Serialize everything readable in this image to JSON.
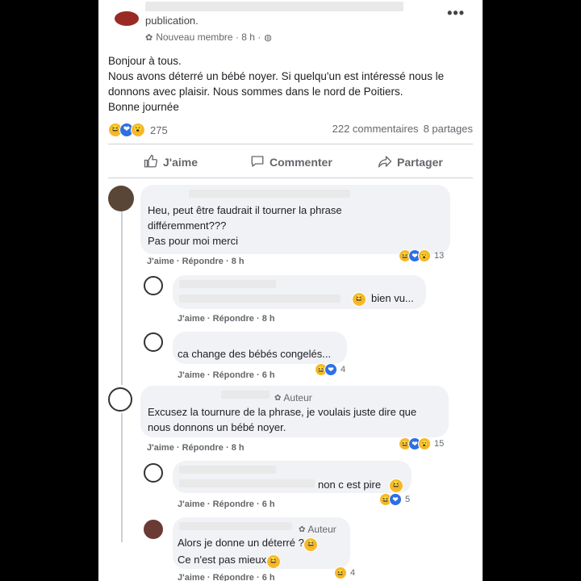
{
  "header": {
    "text": "publication.",
    "meta": "Nouveau membre · 8 h ·",
    "more": "•••"
  },
  "post": {
    "lines": [
      "Bonjour à tous.",
      "Nous avons déterré un bébé noyer. Si quelqu'un est intéressé  nous le",
      "donnons avec plaisir. Nous sommes dans le nord de Poitiers.",
      "Bonne journée"
    ]
  },
  "stats": {
    "reactions": "275",
    "comments": "222 commentaires",
    "shares": "8 partages"
  },
  "actions": {
    "like": "J'aime",
    "comment": "Commenter",
    "share": "Partager"
  },
  "comments": [
    {
      "lines": [
        "Heu, peut être faudrait il tourner la phrase",
        "différemment???",
        "Pas pour moi merci"
      ],
      "meta": "J'aime · Répondre · 8 h",
      "count": "13"
    },
    {
      "lines": [
        "bien vu..."
      ],
      "meta": "J'aime · Répondre · 8 h",
      "count": ""
    },
    {
      "lines": [
        "ca change des bébés congelés..."
      ],
      "meta": "J'aime · Répondre · 6 h",
      "count": "4"
    },
    {
      "author": "Auteur",
      "lines": [
        "Excusez la tournure de la phrase, je voulais juste dire que",
        "nous donnons un bébé noyer."
      ],
      "meta": "J'aime · Répondre · 8 h",
      "count": "15"
    },
    {
      "lines": [
        "non c est pire"
      ],
      "meta": "J'aime · Répondre · 6 h",
      "count": "5"
    },
    {
      "author": "Auteur",
      "lines": [
        "Alors je donne un déterré ?",
        "Ce n'est pas mieux"
      ],
      "meta": "J'aime · Répondre · 6 h",
      "count": "4"
    }
  ],
  "icons": {
    "haha": "😆",
    "love": "❤",
    "wow": "😮"
  },
  "colors": {
    "bubble": "#f0f2f5",
    "secondary_text": "#65676b",
    "love": "#2f6fe4",
    "haha": "#f7b928"
  }
}
